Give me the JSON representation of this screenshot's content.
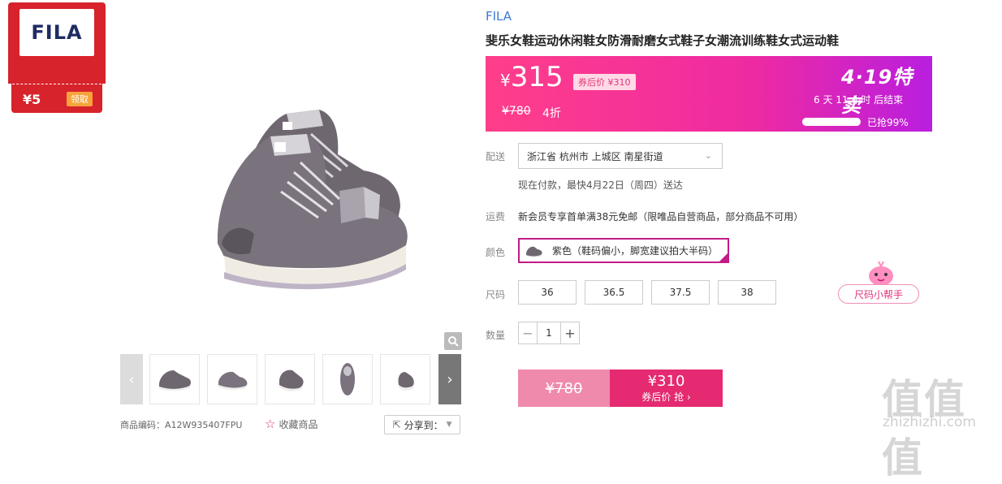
{
  "coupon": {
    "brand_logo_text": "FILA",
    "amount": "¥5",
    "claim_label": "领取"
  },
  "gallery": {
    "zoom_icon": "search-icon",
    "prev_icon": "chevron-left-icon",
    "next_icon": "chevron-right-icon",
    "thumbnails": [
      "shoe-pair-side",
      "shoe-pair-front",
      "shoe-pair-angle",
      "shoe-top",
      "shoe-pair-back"
    ]
  },
  "footer": {
    "product_code": "商品编码：A12W935407FPU",
    "favorite_label": "收藏商品",
    "share_label": "分享到："
  },
  "product": {
    "brand": "FILA",
    "title": "斐乐女鞋运动休闲鞋女防滑耐磨女式鞋子女潮流训练鞋女式运动鞋"
  },
  "price": {
    "currency": "¥",
    "current": "315",
    "after_coupon": "券后价 ¥310",
    "original": "¥780",
    "discount": "4折",
    "promo_title": "4·19特卖",
    "countdown": "6  天  11  小时  后结束",
    "sold_label": "已抢99%",
    "sold_fraction": 0.99
  },
  "shipping": {
    "label": "配送",
    "address": "浙江省 杭州市 上城区 南星街道",
    "delivery": "现在付款，最快4月22日（周四）送达",
    "fee_label": "运费",
    "fee_text": "新会员专享首单满38元免邮（限唯品自营商品，部分商品不可用）"
  },
  "color": {
    "label": "颜色",
    "selected": "紫色（鞋码偏小，脚宽建议拍大半码）"
  },
  "size": {
    "label": "尺码",
    "options": [
      "36",
      "36.5",
      "37.5",
      "38"
    ],
    "helper_label": "尺码小帮手"
  },
  "quantity": {
    "label": "数量",
    "value": "1",
    "minus": "−",
    "plus": "+"
  },
  "buy": {
    "original": "¥780",
    "price": "¥310",
    "sub_label": "券后价 抢 ›"
  },
  "watermark": {
    "text": "值值值",
    "url": "zhizhizhi.com"
  },
  "colors": {
    "accent": "#e52a71",
    "brand_blue": "#3d7bd4",
    "coupon_red": "#d7232b",
    "select_border": "#c21c85"
  }
}
